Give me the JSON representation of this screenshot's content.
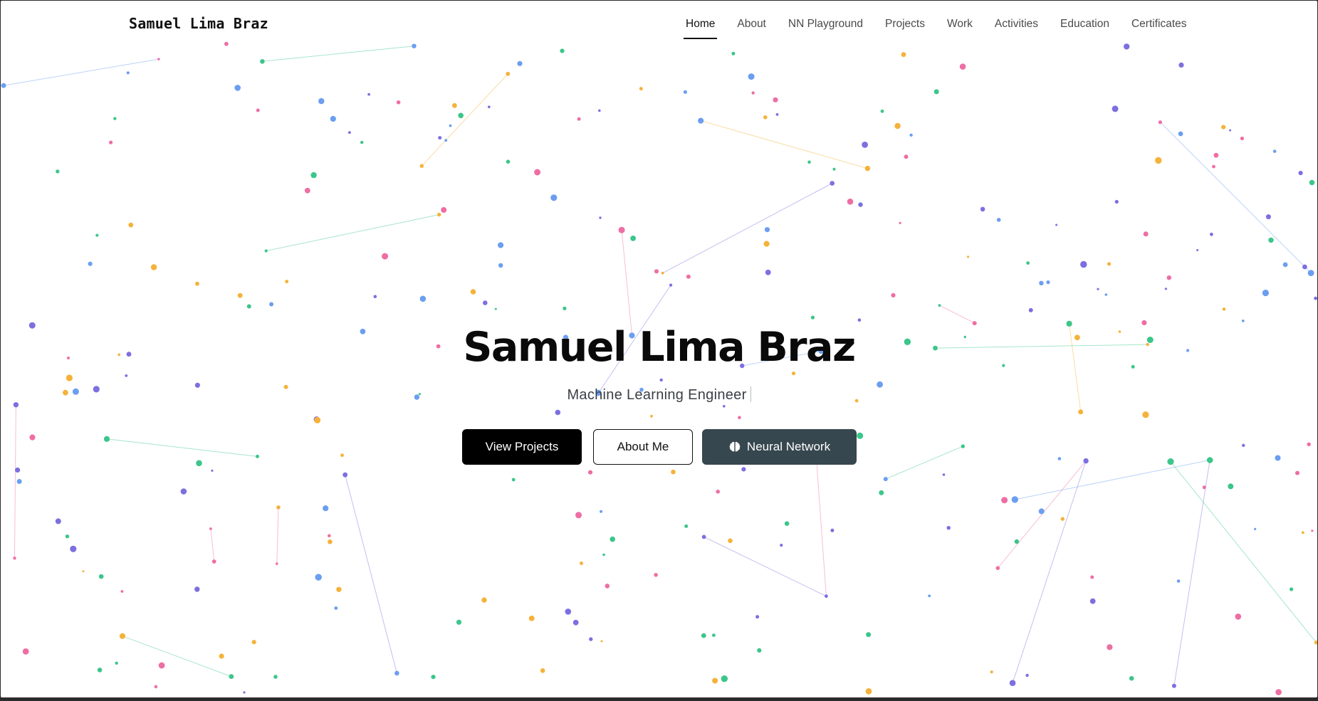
{
  "brand": "Samuel Lima Braz",
  "nav": {
    "items": [
      {
        "label": "Home",
        "active": true
      },
      {
        "label": "About",
        "active": false
      },
      {
        "label": "NN Playground",
        "active": false
      },
      {
        "label": "Projects",
        "active": false
      },
      {
        "label": "Work",
        "active": false
      },
      {
        "label": "Activities",
        "active": false
      },
      {
        "label": "Education",
        "active": false
      },
      {
        "label": "Certificates",
        "active": false
      }
    ]
  },
  "hero": {
    "title": "Samuel Lima Braz",
    "subtitle": "Machine Learning Engineer",
    "buttons": {
      "view_projects": "View Projects",
      "about_me": "About Me",
      "neural_network": "Neural Network"
    }
  },
  "background": {
    "node_colors": [
      "#6b9ef0",
      "#7c6fe0",
      "#3cc68a",
      "#f5b23a",
      "#ee6ea4"
    ],
    "neural_button_color": "#37474f"
  }
}
